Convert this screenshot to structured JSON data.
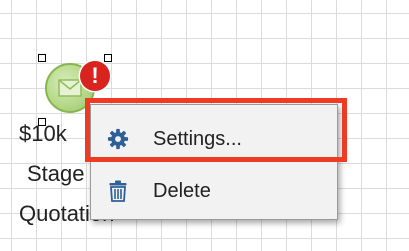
{
  "node": {
    "label_line1": "$10k",
    "label_line2": "Stage",
    "label_line3": "Quotation",
    "alert_symbol": "!",
    "icon": "envelope-icon",
    "alert_color": "#d9231e",
    "fill_color": "#b7d98b"
  },
  "context_menu": {
    "items": [
      {
        "label": "Settings...",
        "icon": "gear-icon",
        "highlighted": true
      },
      {
        "label": "Delete",
        "icon": "trash-icon"
      }
    ],
    "highlight_color": "#ef3b24",
    "icon_color": "#2f5f97"
  }
}
